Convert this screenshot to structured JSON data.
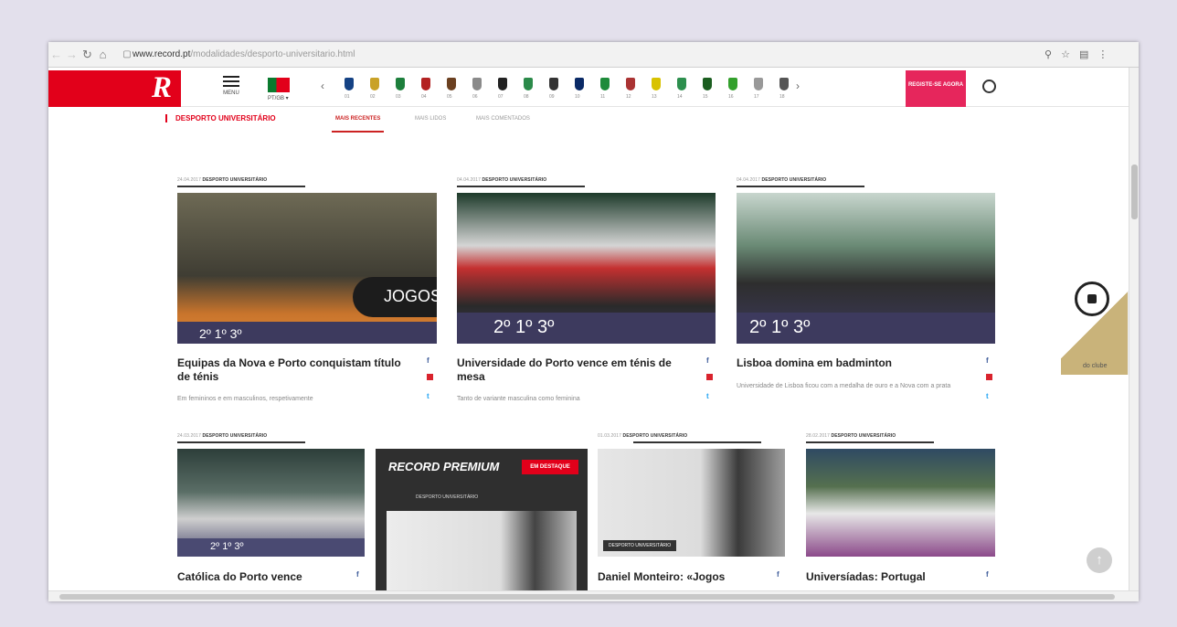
{
  "browser": {
    "url_host": "www.record.pt",
    "url_path": "/modalidades/desporto-universitario.html"
  },
  "nav": {
    "logo": "R",
    "menu_label": "MENU",
    "lang_label": "PT/GB ▾",
    "record_button": "REGISTE-SE AGORA",
    "clubs": [
      "01",
      "02",
      "03",
      "04",
      "05",
      "06",
      "07",
      "08",
      "09",
      "10",
      "11",
      "12",
      "13",
      "14",
      "15",
      "16",
      "17",
      "18"
    ]
  },
  "section": {
    "title": "DESPORTO UNIVERSITÁRIO",
    "tabs": [
      "MAIS RECENTES",
      "MAIS LIDOS",
      "MAIS COMENTADOS"
    ]
  },
  "articles": [
    {
      "meta_date": "24.04.2017",
      "meta_cat": "DESPORTO UNIVERSITÁRIO",
      "title": "Equipas da Nova e Porto conquistam título de ténis",
      "desc": "Em femininos e em masculinos, respetivamente",
      "img_text": "2º   1º   3º"
    },
    {
      "meta_date": "04.04.2017",
      "meta_cat": "DESPORTO UNIVERSITÁRIO",
      "title": "Universidade do Porto vence em ténis de mesa",
      "desc": "Tanto de variante masculina como feminina",
      "img_text": "2º   1º   3º"
    },
    {
      "meta_date": "04.04.2017",
      "meta_cat": "DESPORTO UNIVERSITÁRIO",
      "title": "Lisboa domina em badminton",
      "desc": "Universidade de Lisboa ficou com a medalha de ouro e a Nova com a prata",
      "img_text": "2º   1º   3º"
    },
    {
      "meta_date": "24.03.2017",
      "meta_cat": "DESPORTO UNIVERSITÁRIO",
      "title": "Católica do Porto vence"
    },
    {
      "meta_date": "01.03.2017",
      "meta_cat": "DESPORTO UNIVERSITÁRIO",
      "title": "Daniel Monteiro: «Jogos"
    },
    {
      "meta_date": "28.02.2017",
      "meta_cat": "DESPORTO UNIVERSITÁRIO",
      "title": "Universíadas: Portugal"
    }
  ],
  "premium": {
    "title": "RECORD PREMIUM",
    "badge": "EM DESTAQUE",
    "sub": "DESPORTO UNIVERSITÁRIO"
  },
  "thumb_labels": {
    "jogos": "JOGOS",
    "daniel": "DESPORTO UNIVERSITÁRIO"
  },
  "ad": {
    "text": "do clube"
  }
}
